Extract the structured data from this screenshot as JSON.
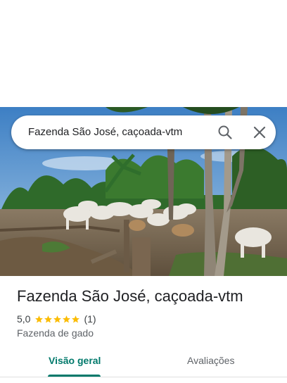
{
  "search": {
    "query": "Fazenda São José, caçoada-vtm"
  },
  "place": {
    "name": "Fazenda São José, caçoada-vtm",
    "rating_value": "5,0",
    "stars": 5,
    "rating_count": "(1)",
    "category": "Fazenda de gado"
  },
  "tabs": {
    "overview": "Visão geral",
    "reviews": "Avaliações"
  },
  "colors": {
    "accent": "#00796b",
    "star": "#fbbc04"
  },
  "icons": {
    "search": "search-icon",
    "close": "close-icon"
  }
}
